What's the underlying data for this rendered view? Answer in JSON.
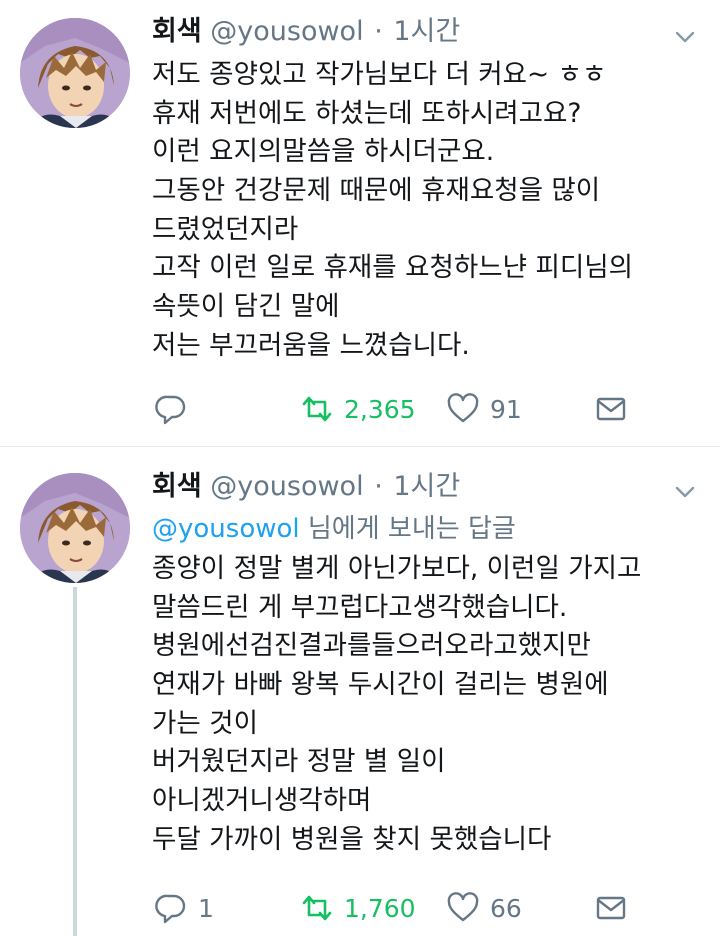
{
  "tweets": [
    {
      "display_name": "회색",
      "handle": "@yousowol",
      "separator": "·",
      "time": "1시간",
      "lines": [
        "저도 종양있고 작가님보다 더 커요~ ㅎㅎ",
        "휴재 저번에도 하셨는데 또하시려고요?",
        "이런 요지의말씀을 하시더군요.",
        "그동안 건강문제 때문에 휴재요청을 많이",
        "드렸었던지라",
        "고작 이런 일로 휴재를 요청하느냔 피디님의",
        "속뜻이 담긴 말에",
        "저는 부끄러움을 느꼈습니다."
      ],
      "reply_count": "",
      "retweet_count": "2,365",
      "like_count": "91",
      "retweeted": true
    },
    {
      "display_name": "회색",
      "handle": "@yousowol",
      "separator": "·",
      "time": "1시간",
      "replying_mention": "@yousowol",
      "replying_suffix": " 님에게 보내는 답글",
      "lines": [
        "종양이 정말 별게 아닌가보다, 이런일 가지고",
        "말씀드린 게 부끄럽다고생각했습니다.",
        "병원에선검진결과를들으러오라고했지만",
        "연재가 바빠 왕복 두시간이 걸리는 병원에",
        "가는 것이",
        "버거웠던지라 정말 별 일이",
        "아니겠거니생각하며",
        "두달 가까이 병원을 찾지 못했습니다"
      ],
      "reply_count": "1",
      "retweet_count": "1,760",
      "like_count": "66",
      "retweeted": true
    }
  ],
  "colors": {
    "text": "#14171a",
    "muted": "#657786",
    "link": "#1da1f2",
    "retweet_green": "#17bf63",
    "divider": "#e1e8ed",
    "thread_line": "#ccd6dd"
  },
  "icons": [
    "reply-icon",
    "retweet-icon",
    "like-icon",
    "direct-message-icon",
    "chevron-down-icon",
    "avatar"
  ]
}
